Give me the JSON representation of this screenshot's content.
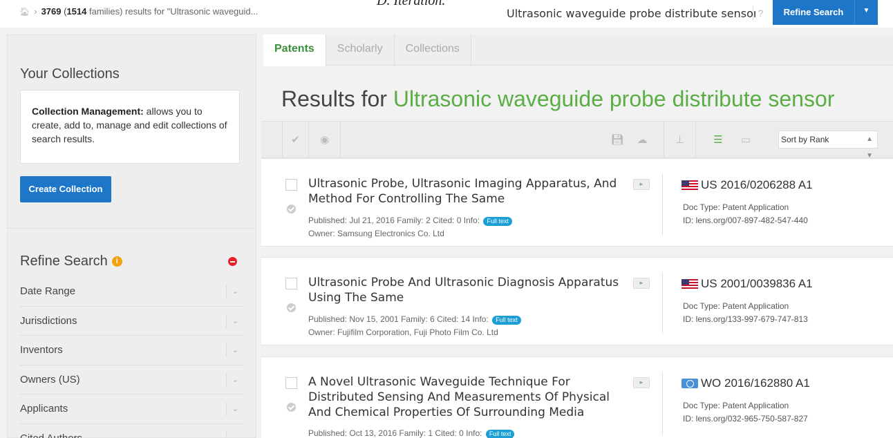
{
  "header": {
    "breadcrumb_count": "3769",
    "breadcrumb_families_count": "1514",
    "breadcrumb_families_label": "families) results for \"Ultrasonic waveguid...",
    "search_value": "Ultrasonic waveguide probe distribute sensor",
    "help_label": "?",
    "refine_label": "Refine Search",
    "partial_text": "D. Iteration."
  },
  "sidebar": {
    "collections_title": "Your Collections",
    "collection_strong": "Collection Management:",
    "collection_text": " allows you to create, add to, manage and edit collections of search results.",
    "create_label": "Create Collection",
    "refine_title": "Refine Search",
    "filters": [
      "Date Range",
      "Jurisdictions",
      "Inventors",
      "Owners (US)",
      "Applicants",
      "Cited Authors"
    ]
  },
  "tabs": [
    "Patents",
    "Scholarly",
    "Collections"
  ],
  "results": {
    "heading_prefix": "Results for ",
    "query": "Ultrasonic waveguide probe distribute sensor",
    "sort_label": "Sort by Rank"
  },
  "items": [
    {
      "title": "Ultrasonic Probe, Ultrasonic Imaging Apparatus, And Method For Controlling The Same",
      "meta": "Published: Jul 21, 2016   Family: 2   Cited: 0   Info:",
      "badge": "Full text",
      "owner": "Owner: Samsung Electronics Co. Ltd",
      "pubno": "US 2016/0206288 A1",
      "doctype": "Doc Type: Patent Application",
      "id": "ID: lens.org/007-897-482-547-440"
    },
    {
      "title": "Ultrasonic Probe And Ultrasonic Diagnosis Apparatus Using The Same",
      "meta": "Published: Nov 15, 2001   Family: 6   Cited: 14   Info:",
      "badge": "Full text",
      "owner": "Owner: Fujifilm Corporation, Fuji Photo Film Co. Ltd",
      "pubno": "US 2001/0039836 A1",
      "doctype": "Doc Type: Patent Application",
      "id": "ID: lens.org/133-997-679-747-813"
    },
    {
      "title": "A Novel Ultrasonic Waveguide Technique For Distributed Sensing And Measurements Of Physical And Chemical Properties Of Surrounding Media",
      "meta": "Published: Oct 13, 2016   Family: 1   Cited: 0   Info:",
      "badge": "Full text",
      "pubno": "WO 2016/162880 A1",
      "doctype": "Doc Type: Patent Application",
      "id": "ID: lens.org/032-965-750-587-827"
    }
  ]
}
